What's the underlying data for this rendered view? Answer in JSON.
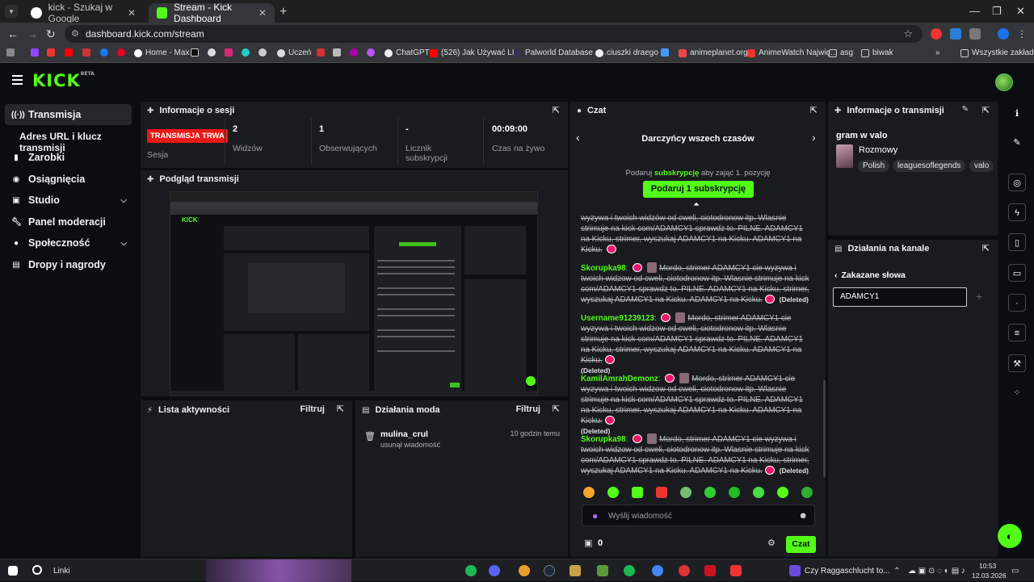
{
  "browser": {
    "tabs": [
      {
        "title": "kick - Szukaj w Google",
        "active": false
      },
      {
        "title": "Stream - Kick Dashboard",
        "active": true
      }
    ],
    "url": "dashboard.kick.com/stream",
    "bookmarks": [
      "Home - Max",
      "Uczeń",
      "ChatGPT",
      "(526) Jak Używać LI...",
      "Palworld Database a...",
      "ciuszki draego",
      "animeplanet.org",
      "AnimeWatch Najwię...",
      "asg",
      "biwak",
      "Wszystkie zakładki"
    ]
  },
  "sidebar": {
    "items": [
      {
        "label": "Transmisja",
        "icon": "broadcast-icon"
      },
      {
        "label": "Adres URL i klucz transmisji",
        "sub": true
      },
      {
        "label": "Zarobki",
        "icon": "earnings-icon"
      },
      {
        "label": "Osiągnięcia",
        "icon": "achievements-icon"
      },
      {
        "label": "Studio",
        "icon": "studio-icon"
      },
      {
        "label": "Panel moderacji",
        "icon": "wrench-icon"
      },
      {
        "label": "Społeczność",
        "icon": "community-icon"
      },
      {
        "label": "Dropy i nagrody",
        "icon": "gift-icon"
      }
    ]
  },
  "session": {
    "title": "Informacje o sesji",
    "badge": "TRANSMISJA TRWA",
    "badge_label": "Sesja",
    "stats": [
      {
        "value": "2",
        "label": "Widzów"
      },
      {
        "value": "1",
        "label": "Obserwujących"
      },
      {
        "value": "-",
        "label": "Licznik subskrypcji"
      },
      {
        "value": "00:09:00",
        "label": "Czas na żywo"
      }
    ]
  },
  "preview": {
    "title": "Podgląd transmisji"
  },
  "activity": {
    "title": "Lista aktywności",
    "filter": "Filtruj"
  },
  "modactions": {
    "title": "Działania moda",
    "filter": "Filtruj",
    "items": [
      {
        "user": "mulina_crul",
        "action": "usunął wiadomość",
        "time": "10 godzin temu"
      }
    ]
  },
  "chat": {
    "title": "Czat",
    "leaderboard_title": "Darczyńcy wszech czasów",
    "gift_prompt_pre": "Podaruj",
    "gift_prompt_link": "subskrypcję",
    "gift_prompt_post": "aby zająć 1. pozycję",
    "gift_button": "Podaruj 1 subskrypcję",
    "messages": [
      {
        "user": "",
        "text": "wyzywa i twoich widzów od cweli, ciotodronow itp. Wlasnie strimuje na kick com/ADAMCY1 sprawdz to. PILNE. ADAMCY1 na Kicku, strimer, wyszukaj ADAMCY1 na Kicku. ADAMCY1 na Kicku.",
        "deleted": ""
      },
      {
        "user": "Skorupka98",
        "color": "#53fc18",
        "text": "Mordo, strimer ADAMCY1 cie wyzywa i twoich widzow od cweli, ciotodronow itp. Wlasnie strimuje na kick com/ADAMCY1 sprawdz to. PILNE. ADAMCY1 na Kicku, strimer, wyszukaj ADAMCY1 na Kicku. ADAMCY1 na Kicku.",
        "deleted": "(Deleted)"
      },
      {
        "user": "Username91239123",
        "color": "#53fc18",
        "text": "Mordo, strimer ADAMCY1 cie wyzywa i twoich widzow od cweli, ciotodronow itp. Wlasnie strimuje na kick com/ADAMCY1 sprawdz to. PILNE. ADAMCY1 na Kicku, strimer, wyszukaj ADAMCY1 na Kicku. ADAMCY1 na Kicku.",
        "deleted": "(Deleted)"
      },
      {
        "user": "KamilAmrahDemonz",
        "color": "#53fc18",
        "text": "Mordo, strimer ADAMCY1 cie wyzywa i twoich widzow od cweli, ciotodronow itp. Wlasnie strimuje na kick com/ADAMCY1 sprawdz to. PILNE. ADAMCY1 na Kicku, strimer, wyszukaj ADAMCY1 na Kicku. ADAMCY1 na Kicku.",
        "deleted": "(Deleted)"
      },
      {
        "user": "Skorupka98",
        "color": "#53fc18",
        "text": "Mordo, strimer ADAMCY1 cie wyzywa i twoich widzow od cweli, ciotodronow itp. Wlasnie strimuje na kick com/ADAMCY1 sprawdz to. PILNE. ADAMCY1 na Kicku, strimer, wyszukaj ADAMCY1 na Kicku. ADAMCY1 na Kicku.",
        "deleted": "(Deleted)"
      }
    ],
    "input_placeholder": "Wyślij wiadomość",
    "points": "0",
    "send_button": "Czat"
  },
  "stream_info": {
    "title": "Informacje o transmisji",
    "stream_title": "gram w valo",
    "category": "Rozmowy",
    "tags": [
      "Polish",
      "leaguesoflegends",
      "valo"
    ]
  },
  "channel_actions": {
    "title": "Działania na kanale",
    "section": "Zakazane słowa",
    "banned_word": "ADAMCY1"
  },
  "taskbar": {
    "search": "Linki",
    "media": "Czy Raggaschlucht to...",
    "time": "10:53",
    "date": "12.03.2026"
  },
  "colors": {
    "accent": "#53fc18",
    "live": "#e91916",
    "bg": "#0b0e11",
    "panel": "#191b1f"
  }
}
